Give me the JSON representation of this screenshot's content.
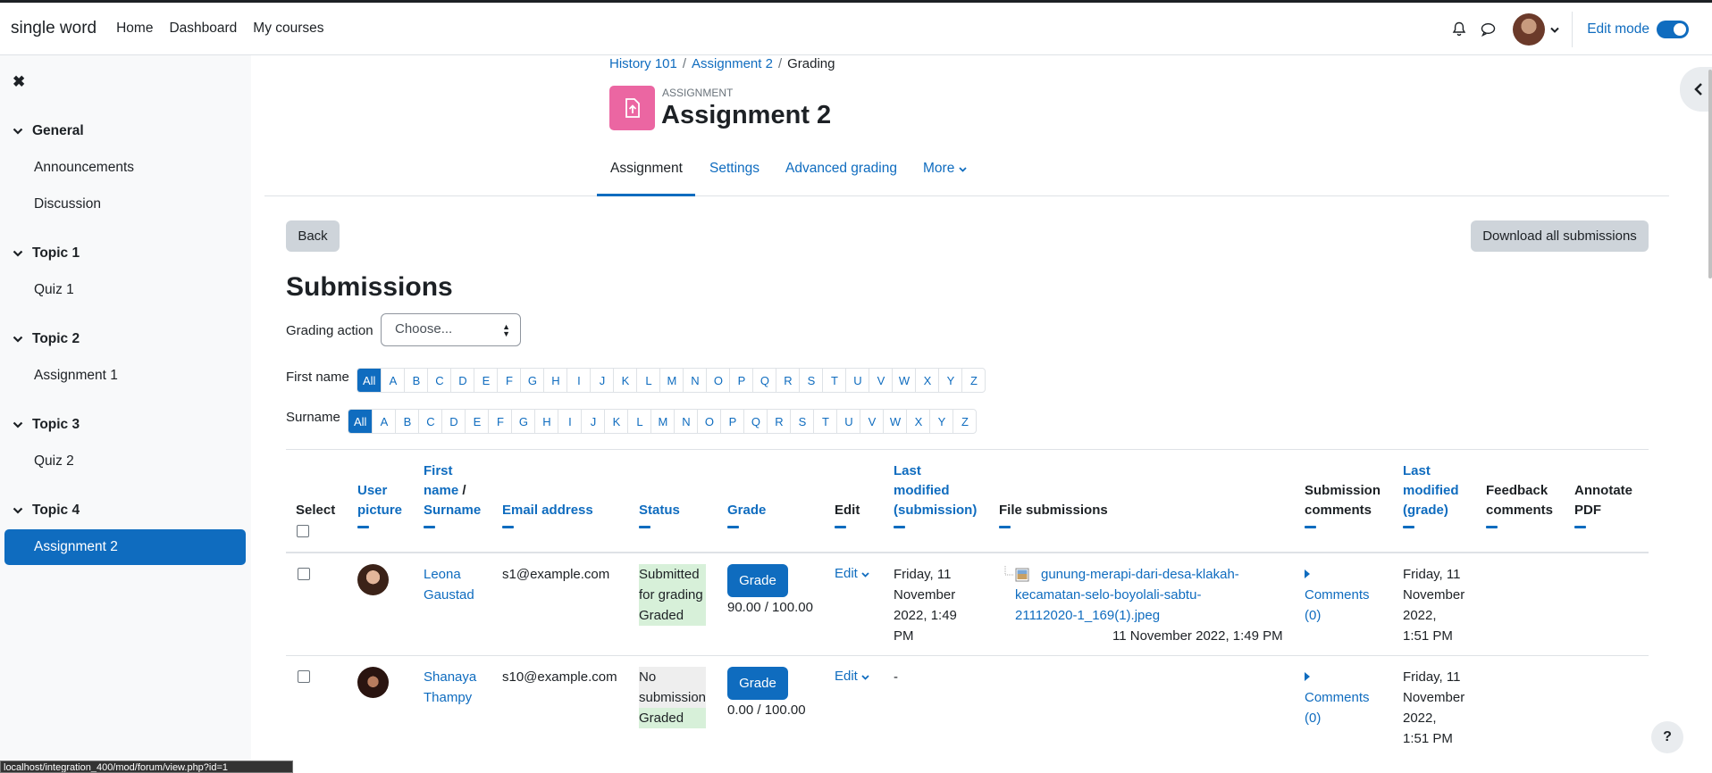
{
  "nav": {
    "site_name": "single word",
    "links": [
      "Home",
      "Dashboard",
      "My courses"
    ],
    "edit_mode_label": "Edit mode"
  },
  "sidebar": {
    "sections": [
      {
        "title": "General",
        "items": [
          "Announcements",
          "Discussion"
        ]
      },
      {
        "title": "Topic 1",
        "items": [
          "Quiz 1"
        ]
      },
      {
        "title": "Topic 2",
        "items": [
          "Assignment 1"
        ]
      },
      {
        "title": "Topic 3",
        "items": [
          "Quiz 2"
        ]
      },
      {
        "title": "Topic 4",
        "items": [
          "Assignment 2"
        ]
      }
    ],
    "active_item": "Assignment 2"
  },
  "breadcrumb": [
    "History 101",
    "Assignment 2",
    "Grading"
  ],
  "activity": {
    "type_label": "ASSIGNMENT",
    "title": "Assignment 2"
  },
  "tabs": [
    "Assignment",
    "Settings",
    "Advanced grading",
    "More"
  ],
  "buttons": {
    "back": "Back",
    "download_all": "Download all submissions"
  },
  "heading": "Submissions",
  "grading_action": {
    "label": "Grading action",
    "selected": "Choose..."
  },
  "initials_bar": {
    "first_name_label": "First name",
    "surname_label": "Surname",
    "letters": [
      "All",
      "A",
      "B",
      "C",
      "D",
      "E",
      "F",
      "G",
      "H",
      "I",
      "J",
      "K",
      "L",
      "M",
      "N",
      "O",
      "P",
      "Q",
      "R",
      "S",
      "T",
      "U",
      "V",
      "W",
      "X",
      "Y",
      "Z"
    ]
  },
  "table": {
    "headers": {
      "select": "Select",
      "user_picture": [
        "User",
        "picture"
      ],
      "first_name": [
        "First",
        "name"
      ],
      "slash": "/",
      "surname": "Surname",
      "email": "Email address",
      "status": "Status",
      "grade": "Grade",
      "edit": "Edit",
      "last_modified_submission": [
        "Last",
        "modified",
        "(submission)"
      ],
      "file_submissions": "File submissions",
      "submission_comments": [
        "Submission",
        "comments"
      ],
      "last_modified_grade": [
        "Last",
        "modified",
        "(grade)"
      ],
      "feedback_comments": [
        "Feedback",
        "comments"
      ],
      "annotate_pdf": [
        "Annotate",
        "PDF"
      ]
    },
    "rows": [
      {
        "first": "Leona",
        "last": "Gaustad",
        "email": "s1@example.com",
        "status": [
          "Submitted",
          "for grading",
          "Graded"
        ],
        "grade_button": "Grade",
        "grade_value": "90.00 / 100.00",
        "edit": "Edit",
        "last_modified_submission": [
          "Friday, 11",
          "November",
          "2022, 1:49",
          "PM"
        ],
        "file": [
          "gunung-merapi-dari-desa-klakah-",
          "kecamatan-selo-boyolali-sabtu-",
          "21112020-1_169(1).jpeg"
        ],
        "file_date": "11 November 2022, 1:49 PM",
        "comments": [
          "Comments",
          "(0)"
        ],
        "last_modified_grade": [
          "Friday, 11",
          "November",
          "2022,",
          "1:51 PM"
        ]
      },
      {
        "first": "Shanaya",
        "last": "Thampy",
        "email": "s10@example.com",
        "status": [
          "No",
          "submission",
          "Graded"
        ],
        "grade_button": "Grade",
        "grade_value": "0.00 / 100.00",
        "edit": "Edit",
        "last_modified_submission": [
          "-"
        ],
        "comments": [
          "Comments",
          "(0)"
        ],
        "last_modified_grade": [
          "Friday, 11",
          "November",
          "2022,",
          "1:51 PM"
        ]
      }
    ]
  },
  "help_label": "?",
  "status_bar_url": "localhost/integration_400/mod/forum/view.php?id=1"
}
